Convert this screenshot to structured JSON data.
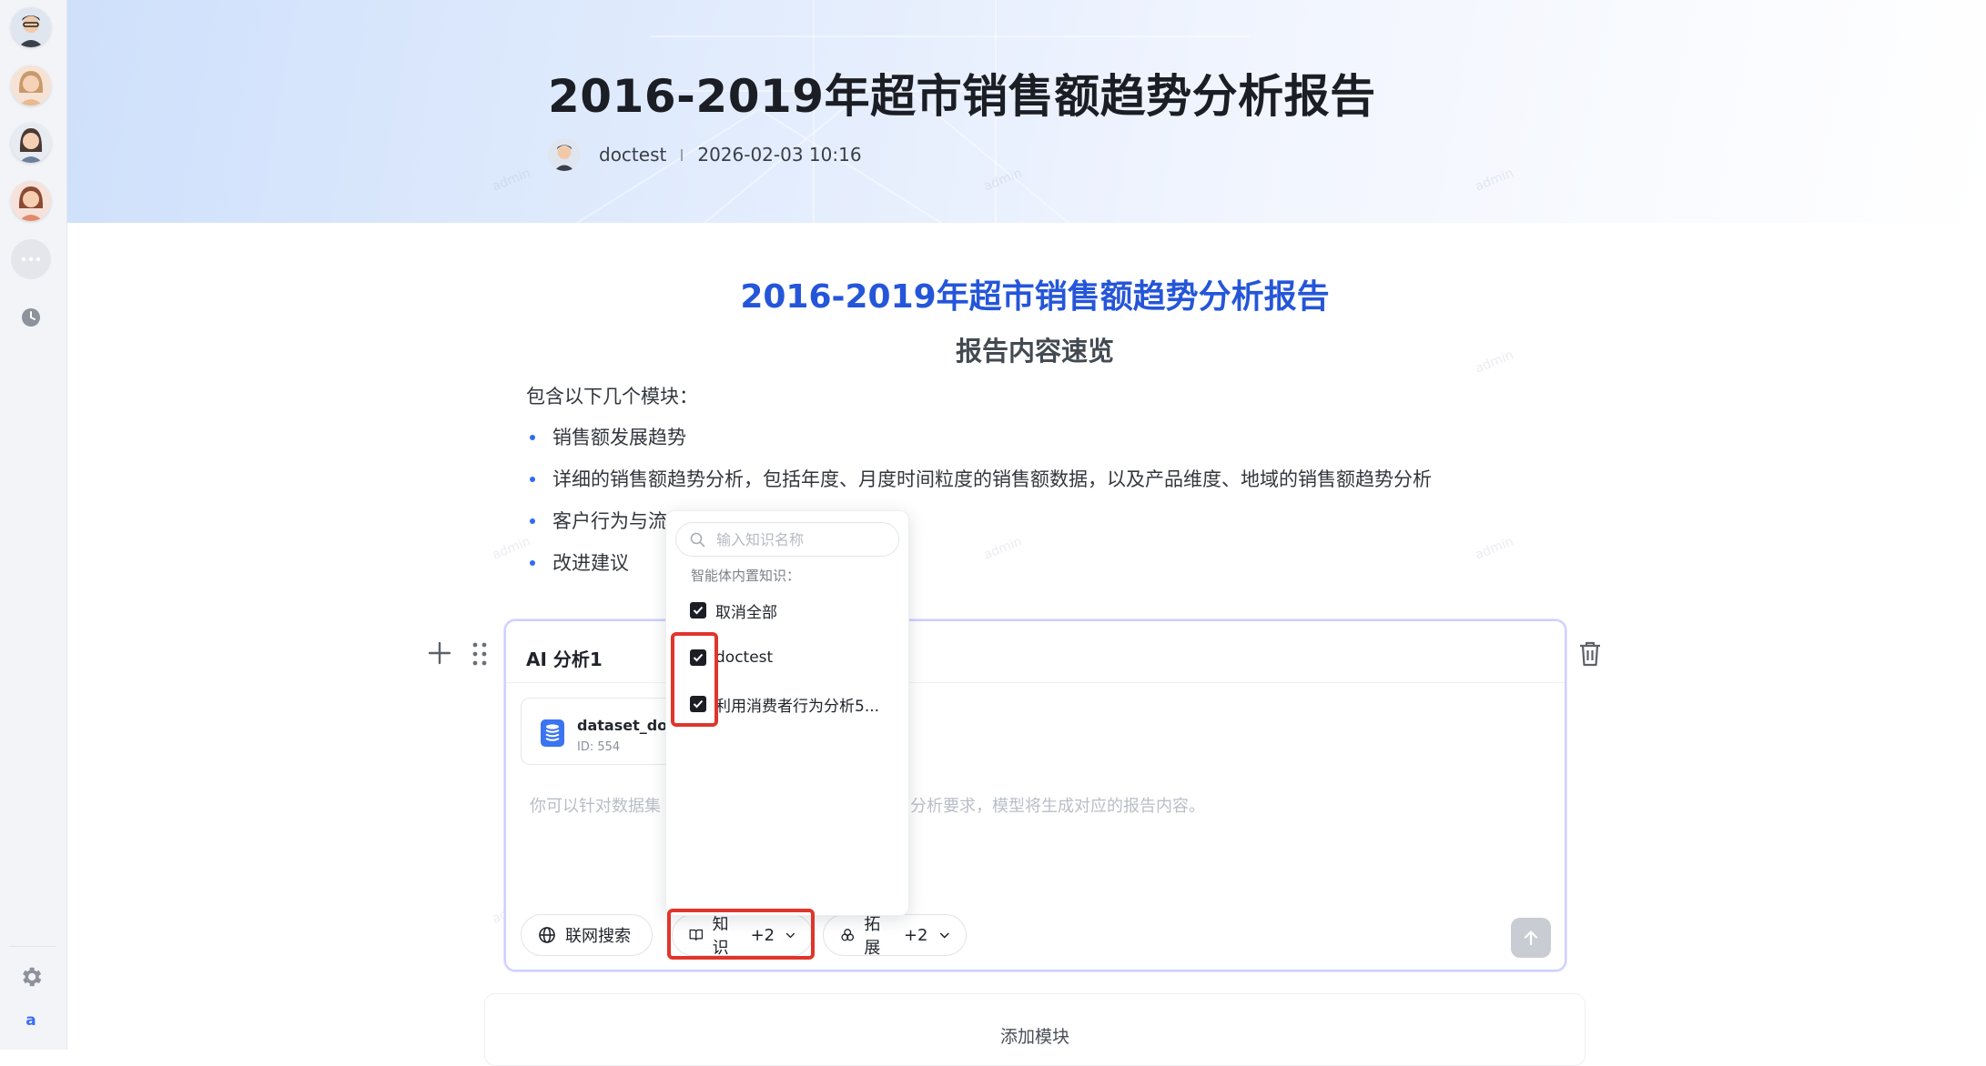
{
  "banner": {
    "title": "2016-2019年超市销售额趋势分析报告",
    "author": "doctest",
    "date": "2026-02-03 10:16"
  },
  "document": {
    "title": "2016-2019年超市销售额趋势分析报告",
    "subtitle": "报告内容速览",
    "intro": "包含以下几个模块：",
    "bullets": [
      "销售额发展趋势",
      "详细的销售额趋势分析，包括年度、月度时间粒度的销售额数据，以及产品维度、地域的销售额趋势分析",
      "客户行为与流",
      "改进建议"
    ]
  },
  "ai_block": {
    "title": "AI 分析1",
    "dataset": {
      "name": "dataset_doct",
      "id": "ID: 554"
    },
    "placeholder_left": "你可以针对数据集",
    "placeholder_right": "分析要求，模型将生成对应的报告内容。",
    "web_search_label": "联网搜索",
    "knowledge_label": "知识",
    "knowledge_count": "+2",
    "extension_label": "拓展",
    "extension_count": "+2"
  },
  "knowledge_dropdown": {
    "search_placeholder": "输入知识名称",
    "section_label": "智能体内置知识：",
    "items": [
      {
        "label": "取消全部",
        "checked": true
      },
      {
        "label": "doctest",
        "checked": true
      },
      {
        "label": "利用消费者行为分析5...",
        "checked": true
      }
    ]
  },
  "add_module_label": "添加模块",
  "sidebar": {
    "user_initial": "a"
  },
  "watermark": "admin",
  "colors": {
    "accent": "#2556d9",
    "highlight": "#e0352b",
    "bullet": "#2f6bf2",
    "sidebar_bg": "#f3f4f7"
  }
}
